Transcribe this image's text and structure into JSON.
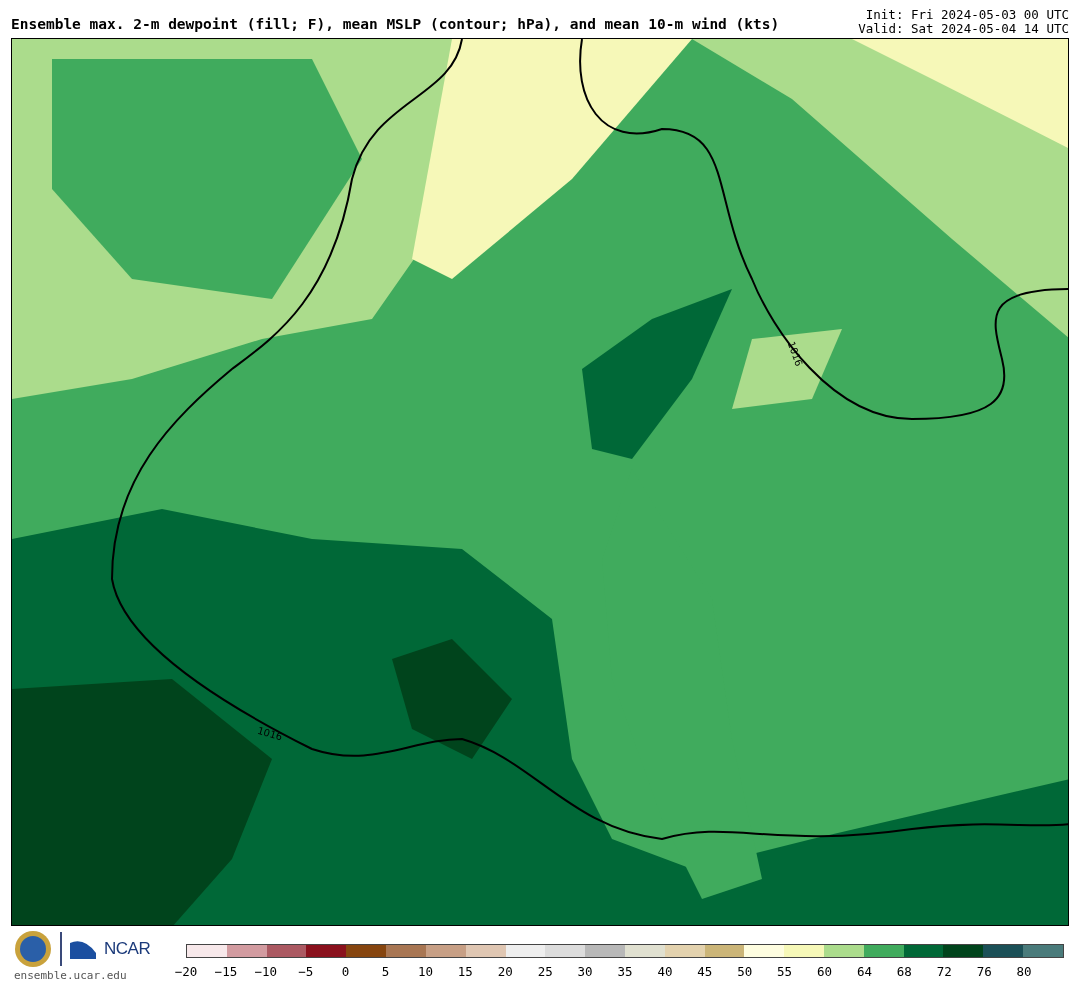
{
  "title": "Ensemble max. 2-m dewpoint (fill; F), mean MSLP (contour; hPa), and mean 10-m wind (kts)",
  "init": "Init: Fri 2024-05-03 00 UTC",
  "valid": "Valid: Sat 2024-05-04 14 UTC",
  "map": {
    "contour_labels": [
      "1016",
      "1016"
    ]
  },
  "footer": {
    "org": "NCAR",
    "url": "ensemble.ucar.edu"
  },
  "colorbar": {
    "bins": [
      {
        "color": "#f7e8ea"
      },
      {
        "color": "#d29ba0"
      },
      {
        "color": "#ab5962"
      },
      {
        "color": "#8a111d"
      },
      {
        "color": "#86450f"
      },
      {
        "color": "#a87653"
      },
      {
        "color": "#c79f85"
      },
      {
        "color": "#dfc6b2"
      },
      {
        "color": "#eeeeee"
      },
      {
        "color": "#dcdcdc"
      },
      {
        "color": "#b8b8b8"
      },
      {
        "color": "#e0e0d0"
      },
      {
        "color": "#e3d2ae"
      },
      {
        "color": "#cbb578"
      },
      {
        "color": "#fefde0"
      },
      {
        "color": "#f6f8b8"
      },
      {
        "color": "#abdc8c"
      },
      {
        "color": "#40ab5d"
      },
      {
        "color": "#006837"
      },
      {
        "color": "#00441c"
      },
      {
        "color": "#1b5057"
      },
      {
        "color": "#4a7b7b"
      }
    ],
    "ticks": [
      "−20",
      "−15",
      "−10",
      "−5",
      "0",
      "5",
      "10",
      "15",
      "20",
      "25",
      "30",
      "35",
      "40",
      "45",
      "50",
      "55",
      "60",
      "64",
      "68",
      "72",
      "76",
      "80"
    ]
  }
}
